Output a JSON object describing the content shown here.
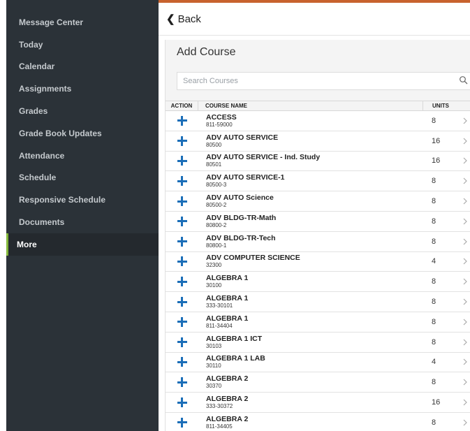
{
  "sidebar": {
    "items": [
      {
        "label": "Message Center"
      },
      {
        "label": "Today"
      },
      {
        "label": "Calendar"
      },
      {
        "label": "Assignments"
      },
      {
        "label": "Grades"
      },
      {
        "label": "Grade Book Updates"
      },
      {
        "label": "Attendance"
      },
      {
        "label": "Schedule"
      },
      {
        "label": "Responsive Schedule"
      },
      {
        "label": "Documents"
      },
      {
        "label": "More",
        "active": true
      }
    ]
  },
  "header": {
    "back_label": "Back"
  },
  "panel": {
    "title": "Add Course",
    "search_placeholder": "Search Courses"
  },
  "table": {
    "columns": {
      "action": "ACTION",
      "name": "COURSE NAME",
      "units": "UNITS"
    },
    "rows": [
      {
        "name": "ACCESS",
        "number": "811-59000",
        "units": "8"
      },
      {
        "name": "ADV AUTO SERVICE",
        "number": "80500",
        "units": "16"
      },
      {
        "name": "ADV AUTO SERVICE - Ind. Study",
        "number": "80501",
        "units": "16"
      },
      {
        "name": "ADV AUTO SERVICE-1",
        "number": "80500-3",
        "units": "8"
      },
      {
        "name": "ADV AUTO Science",
        "number": "80500-2",
        "units": "8"
      },
      {
        "name": "ADV BLDG-TR-Math",
        "number": "80800-2",
        "units": "8"
      },
      {
        "name": "ADV BLDG-TR-Tech",
        "number": "80800-1",
        "units": "8"
      },
      {
        "name": "ADV COMPUTER SCIENCE",
        "number": "32300",
        "units": "4"
      },
      {
        "name": "ALGEBRA 1",
        "number": "30100",
        "units": "8"
      },
      {
        "name": "ALGEBRA 1",
        "number": "333-30101",
        "units": "8"
      },
      {
        "name": "ALGEBRA 1",
        "number": "811-34404",
        "units": "8"
      },
      {
        "name": "ALGEBRA 1 ICT",
        "number": "30103",
        "units": "8"
      },
      {
        "name": "ALGEBRA 1 LAB",
        "number": "30110",
        "units": "4"
      },
      {
        "name": "ALGEBRA 2",
        "number": "30370",
        "units": "8"
      },
      {
        "name": "ALGEBRA 2",
        "number": "333-30372",
        "units": "16"
      },
      {
        "name": "ALGEBRA 2",
        "number": "811-34405",
        "units": "8"
      }
    ]
  },
  "colors": {
    "sidebar_bg": "#2b3238",
    "active_accent": "#84b83b",
    "top_accent": "#c8622e",
    "plus_blue": "#1b6eb8"
  },
  "icons": {
    "back": "chevron-left-icon",
    "search": "search-icon",
    "add": "plus-icon",
    "row_nav": "chevron-right-icon"
  }
}
